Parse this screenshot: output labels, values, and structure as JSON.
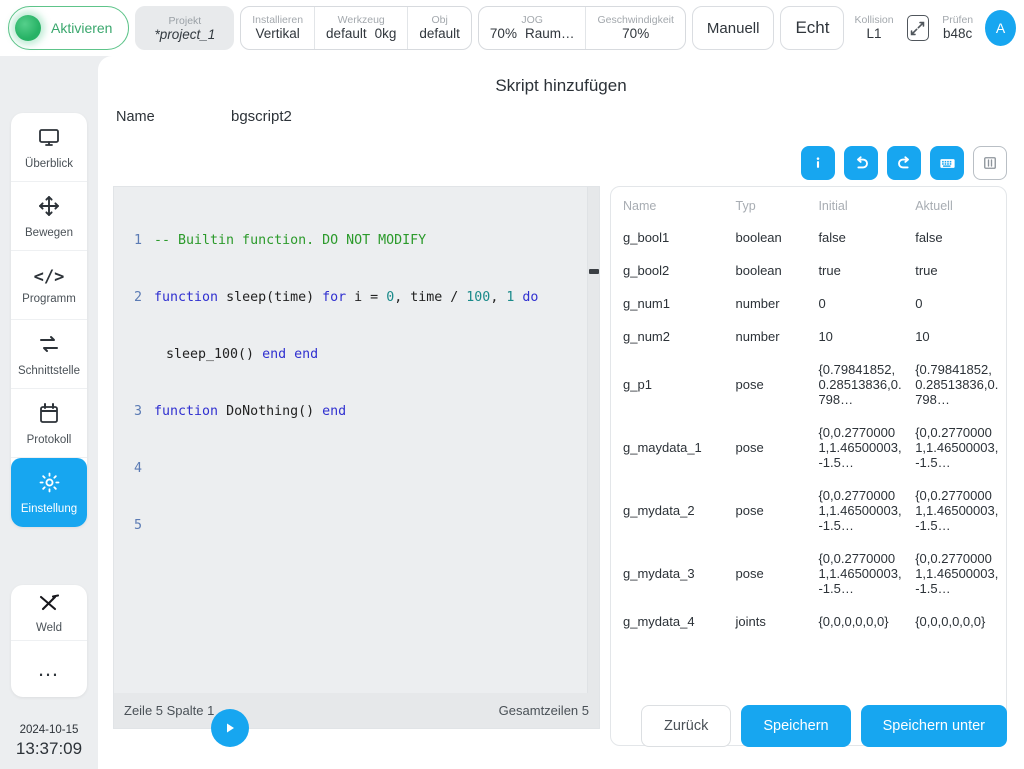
{
  "topbar": {
    "activate_label": "Aktivieren",
    "project": {
      "key": "Projekt",
      "value": "*project_1"
    },
    "install": {
      "key": "Installieren",
      "value": "Vertikal"
    },
    "tool": {
      "key": "Werkzeug",
      "value": "default",
      "weight": "0kg"
    },
    "obj": {
      "key": "Obj",
      "value": "default"
    },
    "jog": {
      "key": "JOG",
      "percent": "70%",
      "mode": "Raum…"
    },
    "speed": {
      "key": "Geschwindigkeit",
      "value": "70%"
    },
    "mode_manual": "Manuell",
    "mode_real": "Echt",
    "collision": {
      "key": "Kollision",
      "value": "L1"
    },
    "check": {
      "key": "Prüfen",
      "value": "b48c"
    },
    "avatar_initial": "A"
  },
  "sidebar": {
    "items": [
      {
        "label": "Überblick",
        "icon": "monitor-icon",
        "active": false
      },
      {
        "label": "Bewegen",
        "icon": "move-icon",
        "active": false
      },
      {
        "label": "Programm",
        "icon": "code-icon",
        "active": false
      },
      {
        "label": "Schnittstelle",
        "icon": "exchange-icon",
        "active": false
      },
      {
        "label": "Protokoll",
        "icon": "calendar-icon",
        "active": false
      },
      {
        "label": "Einstellung",
        "icon": "gear-icon",
        "active": true
      }
    ],
    "tools": [
      {
        "label": "Weld",
        "icon": "weld-icon"
      },
      {
        "label": "…",
        "icon": "more-icon"
      }
    ],
    "clock": {
      "date": "2024-10-15",
      "time": "13:37:09"
    }
  },
  "main": {
    "page_title": "Skript hinzufügen",
    "name_label": "Name",
    "name_value": "bgscript2",
    "icon_buttons": [
      {
        "name": "info-icon",
        "glyph": "i",
        "style": "primary"
      },
      {
        "name": "undo-icon",
        "glyph": "undo",
        "style": "primary"
      },
      {
        "name": "redo-icon",
        "glyph": "redo",
        "style": "primary"
      },
      {
        "name": "keyboard-icon",
        "glyph": "keyboard",
        "style": "primary"
      },
      {
        "name": "panel-columns-icon",
        "glyph": "columns",
        "style": "ghost"
      }
    ]
  },
  "editor": {
    "lines": [
      {
        "no": "1",
        "tokens": [
          {
            "t": "-- Builtin function. DO NOT MODIFY",
            "c": "cl-com"
          }
        ]
      },
      {
        "no": "2",
        "tokens": [
          {
            "t": "function ",
            "c": "cl-kw"
          },
          {
            "t": "sleep(time) ",
            "c": "cl-pl"
          },
          {
            "t": "for ",
            "c": "cl-kw"
          },
          {
            "t": "i = ",
            "c": "cl-pl"
          },
          {
            "t": "0",
            "c": "cl-num"
          },
          {
            "t": ", time / ",
            "c": "cl-pl"
          },
          {
            "t": "100",
            "c": "cl-num"
          },
          {
            "t": ", ",
            "c": "cl-pl"
          },
          {
            "t": "1 ",
            "c": "cl-num"
          },
          {
            "t": "do",
            "c": "cl-kw"
          }
        ],
        "cont": [
          {
            "t": "sleep_100() ",
            "c": "cl-pl"
          },
          {
            "t": "end end",
            "c": "cl-kw"
          }
        ]
      },
      {
        "no": "3",
        "tokens": [
          {
            "t": "function ",
            "c": "cl-kw"
          },
          {
            "t": "DoNothing() ",
            "c": "cl-pl"
          },
          {
            "t": "end",
            "c": "cl-kw"
          }
        ]
      },
      {
        "no": "4",
        "tokens": [
          {
            "t": "",
            "c": "cl-pl"
          }
        ]
      },
      {
        "no": "5",
        "tokens": [
          {
            "t": "",
            "c": "cl-pl"
          }
        ]
      }
    ],
    "status_left": "Zeile 5 Spalte 1",
    "status_right": "Gesamtzeilen 5"
  },
  "variables": {
    "columns": [
      "Name",
      "Typ",
      "Initial",
      "Aktuell"
    ],
    "rows": [
      {
        "name": "g_bool1",
        "type": "boolean",
        "initial": "false",
        "current": "false"
      },
      {
        "name": "g_bool2",
        "type": "boolean",
        "initial": "true",
        "current": "true"
      },
      {
        "name": "g_num1",
        "type": "number",
        "initial": "0",
        "current": "0"
      },
      {
        "name": "g_num2",
        "type": "number",
        "initial": "10",
        "current": "10"
      },
      {
        "name": "g_p1",
        "type": "pose",
        "initial": "{0.79841852,0.28513836,0.798…",
        "current": "{0.79841852,0.28513836,0.798…"
      },
      {
        "name": "g_maydata_1",
        "type": "pose",
        "initial": "{0,0.27700001,1.46500003,-1.5…",
        "current": "{0,0.27700001,1.46500003,-1.5…"
      },
      {
        "name": "g_mydata_2",
        "type": "pose",
        "initial": "{0,0.27700001,1.46500003,-1.5…",
        "current": "{0,0.27700001,1.46500003,-1.5…"
      },
      {
        "name": "g_mydata_3",
        "type": "pose",
        "initial": "{0,0.27700001,1.46500003,-1.5…",
        "current": "{0,0.27700001,1.46500003,-1.5…"
      },
      {
        "name": "g_mydata_4",
        "type": "joints",
        "initial": "{0,0,0,0,0,0}",
        "current": "{0,0,0,0,0,0}"
      }
    ]
  },
  "footer": {
    "back": "Zurück",
    "save": "Speichern",
    "save_as": "Speichern unter"
  },
  "colors": {
    "accent": "#17a6f0",
    "activate_green": "#3aa76d",
    "panel_bg": "#eceef0",
    "comment_green": "#2b9a2b",
    "keyword_blue": "#3030d0"
  }
}
